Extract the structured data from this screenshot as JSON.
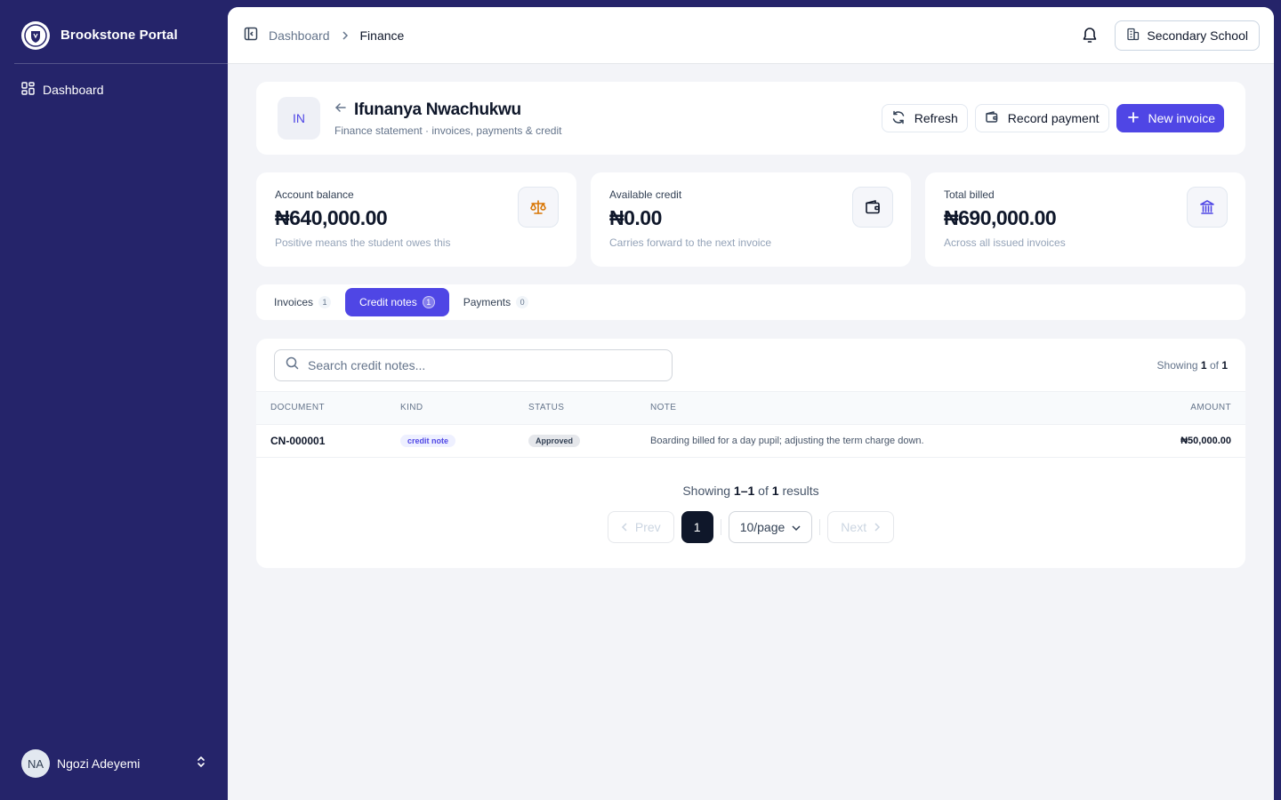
{
  "app": {
    "name": "Brookstone Portal"
  },
  "sidebar": {
    "items": [
      {
        "label": "Dashboard",
        "icon": "grid-icon"
      }
    ]
  },
  "user": {
    "initials": "NA",
    "name": "Ngozi Adeyemi"
  },
  "breadcrumb": {
    "parent": "Dashboard",
    "current": "Finance"
  },
  "school_selector": {
    "label": "Secondary School"
  },
  "student": {
    "initials": "IN",
    "name": "Ifunanya Nwachukwu",
    "subtitle": "Finance statement · invoices, payments & credit"
  },
  "actions": {
    "refresh": "Refresh",
    "record_payment": "Record payment",
    "new_invoice": "New invoice"
  },
  "stats": [
    {
      "label": "Account balance",
      "value": "₦640,000.00",
      "note": "Positive means the student owes this",
      "icon": "scale-icon",
      "icon_color": "#d97706"
    },
    {
      "label": "Available credit",
      "value": "₦0.00",
      "note": "Carries forward to the next invoice",
      "icon": "wallet-icon",
      "icon_color": "#0f172a"
    },
    {
      "label": "Total billed",
      "value": "₦690,000.00",
      "note": "Across all issued invoices",
      "icon": "bank-icon",
      "icon_color": "#4f46e5"
    }
  ],
  "tabs": [
    {
      "label": "Invoices",
      "count": "1",
      "active": false
    },
    {
      "label": "Credit notes",
      "count": "1",
      "active": true
    },
    {
      "label": "Payments",
      "count": "0",
      "active": false
    }
  ],
  "search": {
    "placeholder": "Search credit notes...",
    "value": ""
  },
  "showing_top": {
    "prefix": "Showing",
    "current": "1",
    "of": "of",
    "total": "1"
  },
  "table": {
    "columns": {
      "document": "DOCUMENT",
      "kind": "KIND",
      "status": "STATUS",
      "note": "NOTE",
      "amount": "AMOUNT"
    },
    "rows": [
      {
        "document": "CN-000001",
        "kind": "credit note",
        "status": "Approved",
        "note": "Boarding billed for a day pupil; adjusting the term charge down.",
        "amount": "₦50,000.00"
      }
    ]
  },
  "pagination": {
    "showing": "Showing",
    "range": "1–1",
    "of": "of",
    "total": "1",
    "results": "results",
    "prev": "Prev",
    "page": "1",
    "per_page": "10/page",
    "next": "Next"
  },
  "colors": {
    "sidebar_bg": "#25246a",
    "accent": "#4f46e5",
    "content_bg": "#f3f4f8"
  }
}
